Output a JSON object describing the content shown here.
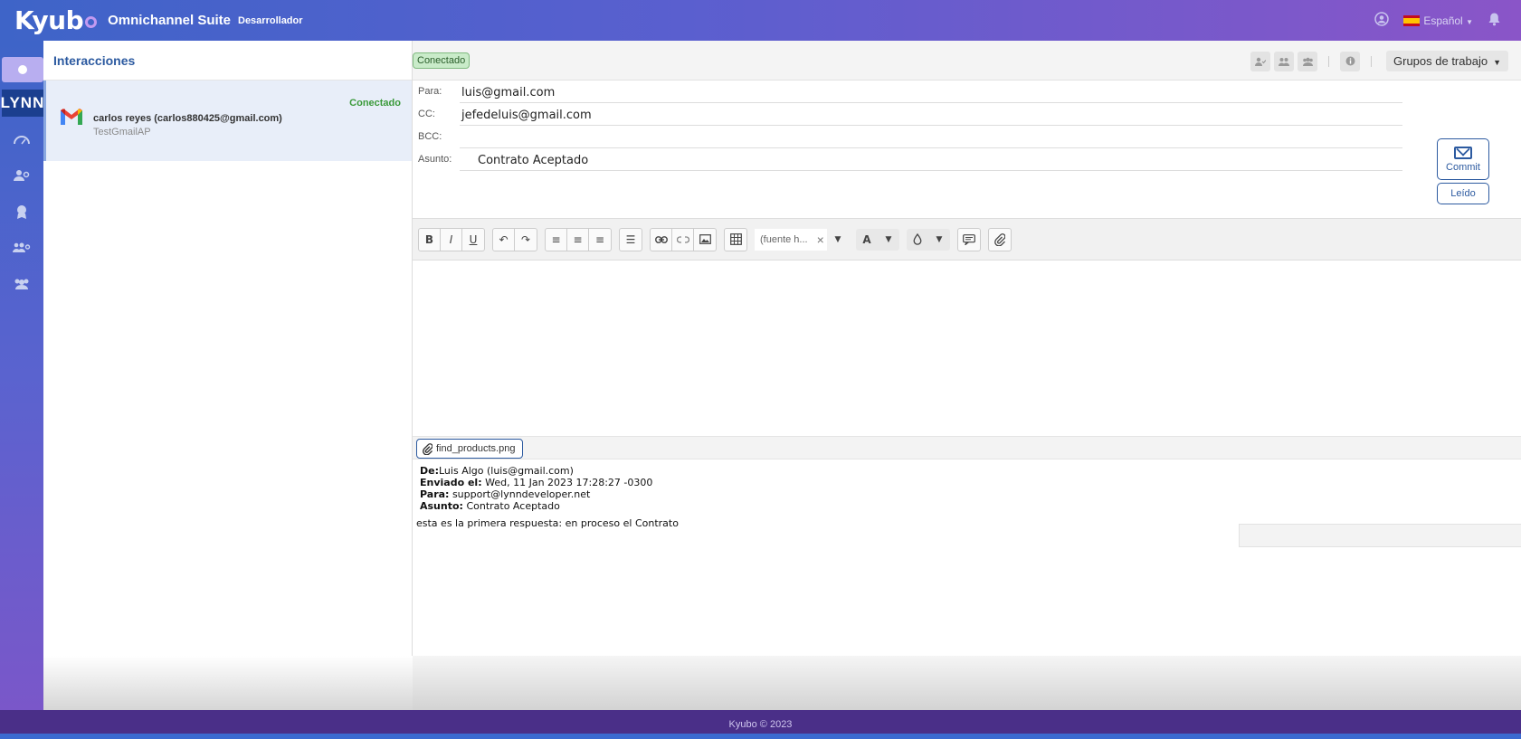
{
  "header": {
    "logo": "Kyub",
    "title": "Omnichannel Suite",
    "subtitle": "Desarrollador",
    "language": "Español"
  },
  "rail": {
    "brand": "LYNN"
  },
  "interactions": {
    "title": "Interacciones",
    "items": [
      {
        "name": "carlos reyes (carlos880425@gmail.com)",
        "account": "TestGmailAP",
        "status": "Conectado"
      }
    ]
  },
  "main": {
    "connection_badge": "Conectado",
    "workgroups_label": "Grupos de trabajo",
    "fields": {
      "to_label": "Para:",
      "to_value": "luis@gmail.com",
      "cc_label": "CC:",
      "cc_value": "jefedeluis@gmail.com",
      "bcc_label": "BCC:",
      "bcc_value": "",
      "subject_label": "Asunto:",
      "subject_value": "Contrato Aceptado"
    },
    "commit_label": "Commit",
    "read_label": "Leído",
    "toolbar": {
      "bold": "B",
      "italic": "I",
      "underline": "U",
      "font_placeholder": "(fuente h...",
      "font_color": "A"
    },
    "attachment": "find_products.png",
    "quoted": {
      "from_label": "De:",
      "from_value": "Luis Algo (luis@gmail.com)",
      "sent_label": "Enviado el:",
      "sent_value": "Wed, 11 Jan 2023 17:28:27 -0300",
      "to_label": "Para:",
      "to_value": "support@lynndeveloper.net",
      "subject_label": "Asunto:",
      "subject_value": "Contrato Aceptado",
      "body": "esta es la primera respuesta: en proceso el Contrato"
    }
  },
  "footer": {
    "text": "Kyubo © 2023"
  }
}
